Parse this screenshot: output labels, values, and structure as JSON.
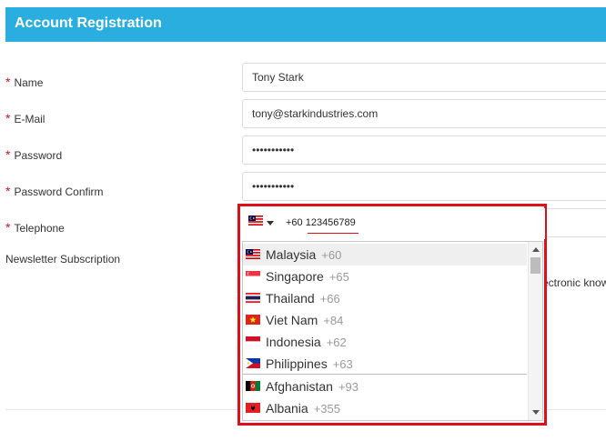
{
  "header": {
    "title": "Account Registration"
  },
  "form": {
    "required_mark": "*",
    "name": {
      "label": "Name",
      "value": "Tony Stark"
    },
    "email": {
      "label": "E-Mail",
      "value": "tony@starkindustries.com"
    },
    "password": {
      "label": "Password",
      "value": "•••••••••••"
    },
    "confirm": {
      "label": "Password Confirm",
      "value": "•••••••••••"
    },
    "telephone": {
      "label": "Telephone",
      "value": "+60 123456789"
    },
    "newsletter": {
      "label": "Newsletter Subscription",
      "partial_text": "ectronic know"
    }
  },
  "phone_picker": {
    "selected_flag_icon": "malaysia-flag-icon",
    "countries": [
      {
        "name": "Malaysia",
        "dial": "+60",
        "flag_icon": "malaysia-flag-icon"
      },
      {
        "name": "Singapore",
        "dial": "+65",
        "flag_icon": "singapore-flag-icon"
      },
      {
        "name": "Thailand",
        "dial": "+66",
        "flag_icon": "thailand-flag-icon"
      },
      {
        "name": "Viet Nam",
        "dial": "+84",
        "flag_icon": "vietnam-flag-icon"
      },
      {
        "name": "Indonesia",
        "dial": "+62",
        "flag_icon": "indonesia-flag-icon"
      },
      {
        "name": "Philippines",
        "dial": "+63",
        "flag_icon": "philippines-flag-icon"
      },
      {
        "name": "Afghanistan",
        "dial": "+93",
        "flag_icon": "afghanistan-flag-icon"
      },
      {
        "name": "Albania",
        "dial": "+355",
        "flag_icon": "albania-flag-icon"
      }
    ]
  },
  "colors": {
    "header_bg": "#2aaee0",
    "required": "#c8102e",
    "highlight_border": "#e0101a"
  }
}
